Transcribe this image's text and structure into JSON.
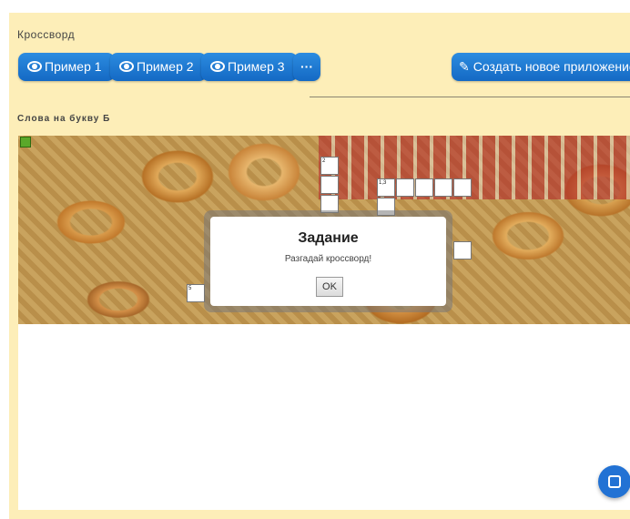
{
  "app": {
    "title": "Кроссворд"
  },
  "toolbar": {
    "example1_label": "Пример 1",
    "example2_label": "Пример 2",
    "example3_label": "Пример 3",
    "more_label": "···",
    "create_label": "Создать новое приложение"
  },
  "section": {
    "title": "Слова на букву Б"
  },
  "crossword": {
    "cell_numbers": {
      "two": "2",
      "one_three": "1,3",
      "five": "5"
    }
  },
  "dialog": {
    "title": "Задание",
    "message": "Разгадай кроссворд!",
    "ok_label": "OK"
  },
  "colors": {
    "accent": "#1a73d3",
    "panel": "#fdeeb8"
  },
  "icons": {
    "eye": "eye-icon",
    "pencil": "pencil-icon",
    "fab": "check-square-icon"
  }
}
